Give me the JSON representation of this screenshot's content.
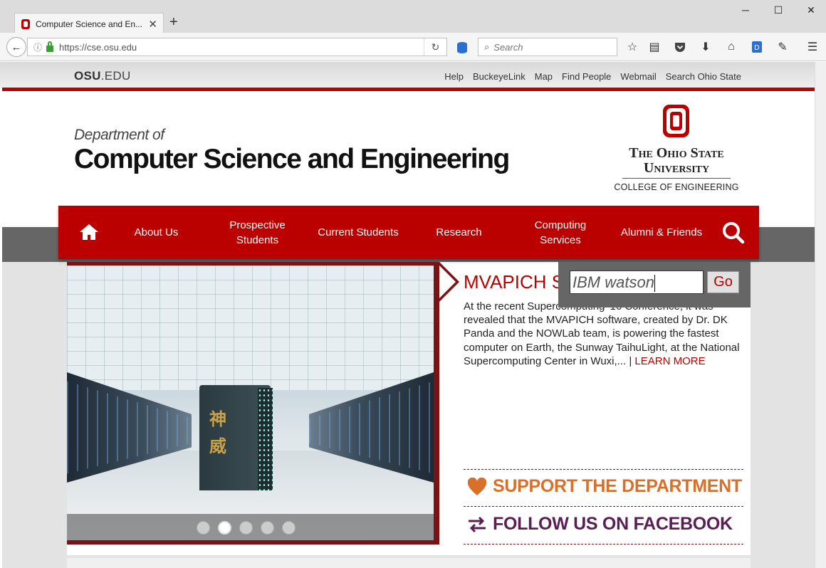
{
  "browser": {
    "tab_title": "Computer Science and En...",
    "url": "https://cse.osu.edu",
    "search_placeholder": "Search"
  },
  "osu_bar": {
    "logo_bold": "OSU",
    "logo_rest": ".EDU",
    "links": [
      "Help",
      "BuckeyeLink",
      "Map",
      "Find People",
      "Webmail",
      "Search Ohio State"
    ]
  },
  "header": {
    "dept_of": "Department of",
    "dept_name": "Computer Science and Engineering",
    "univ_line1": "The Ohio State",
    "univ_line2": "University",
    "college": "COLLEGE OF ENGINEERING"
  },
  "nav": {
    "items": [
      "About Us",
      "Prospective Students",
      "Current Students",
      "Research",
      "Computing Services",
      "Alumni & Friends"
    ]
  },
  "slide": {
    "glyphs": [
      "神",
      "威"
    ]
  },
  "news": {
    "title": "MVAPICH S",
    "body": "At the recent Supercomputing '16 Conference, it was revealed that the MVAPICH software, created by Dr. DK Panda and the NOWLab team, is powering the fastest computer on Earth, the Sunway TaihuLight, at the National Supercomputing Center in Wuxi,... | ",
    "more": "LEARN MORE"
  },
  "search_popup": {
    "query": "IBM watson",
    "go_label": "Go"
  },
  "callouts": {
    "support": "SUPPORT THE DEPARTMENT",
    "follow": "FOLLOW US ON FACEBOOK"
  },
  "colors": {
    "scarlet": "#bb0000",
    "dark_red": "#7a1414",
    "orange": "#d8702a",
    "purple": "#5a1e55"
  }
}
